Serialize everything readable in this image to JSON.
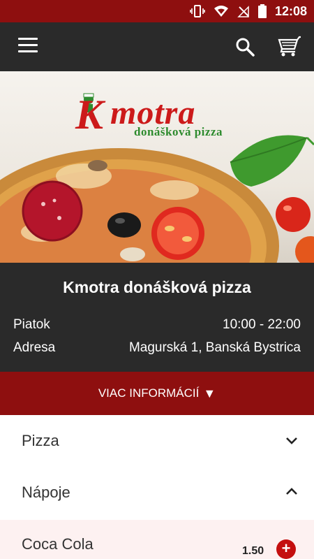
{
  "status_bar": {
    "time": "12:08"
  },
  "app_bar": {
    "icons": [
      "menu-icon",
      "search-icon",
      "cart-icon"
    ]
  },
  "hero": {
    "brand": "motra",
    "brand_initial": "K",
    "tagline": "donášková pizza"
  },
  "restaurant": {
    "name": "Kmotra donášková pizza",
    "day_label": "Piatok",
    "hours": "10:00 - 22:00",
    "address_label": "Adresa",
    "address": "Magurská 1, Banská Bystrica"
  },
  "more_info": {
    "label": "VIAC INFORMÁCIÍ",
    "arrow": "▼"
  },
  "categories": [
    {
      "label": "Pizza",
      "expanded": false
    },
    {
      "label": "Nápoje",
      "expanded": true
    }
  ],
  "items": [
    {
      "name": "Coca Cola",
      "price": "1.50",
      "add_symbol": "+"
    }
  ],
  "colors": {
    "accent": "#8e0f0f",
    "dark": "#2a2a2a",
    "add_button": "#c40f0f",
    "logo_red": "#cc1a1a",
    "logo_green": "#2e8b2e"
  }
}
